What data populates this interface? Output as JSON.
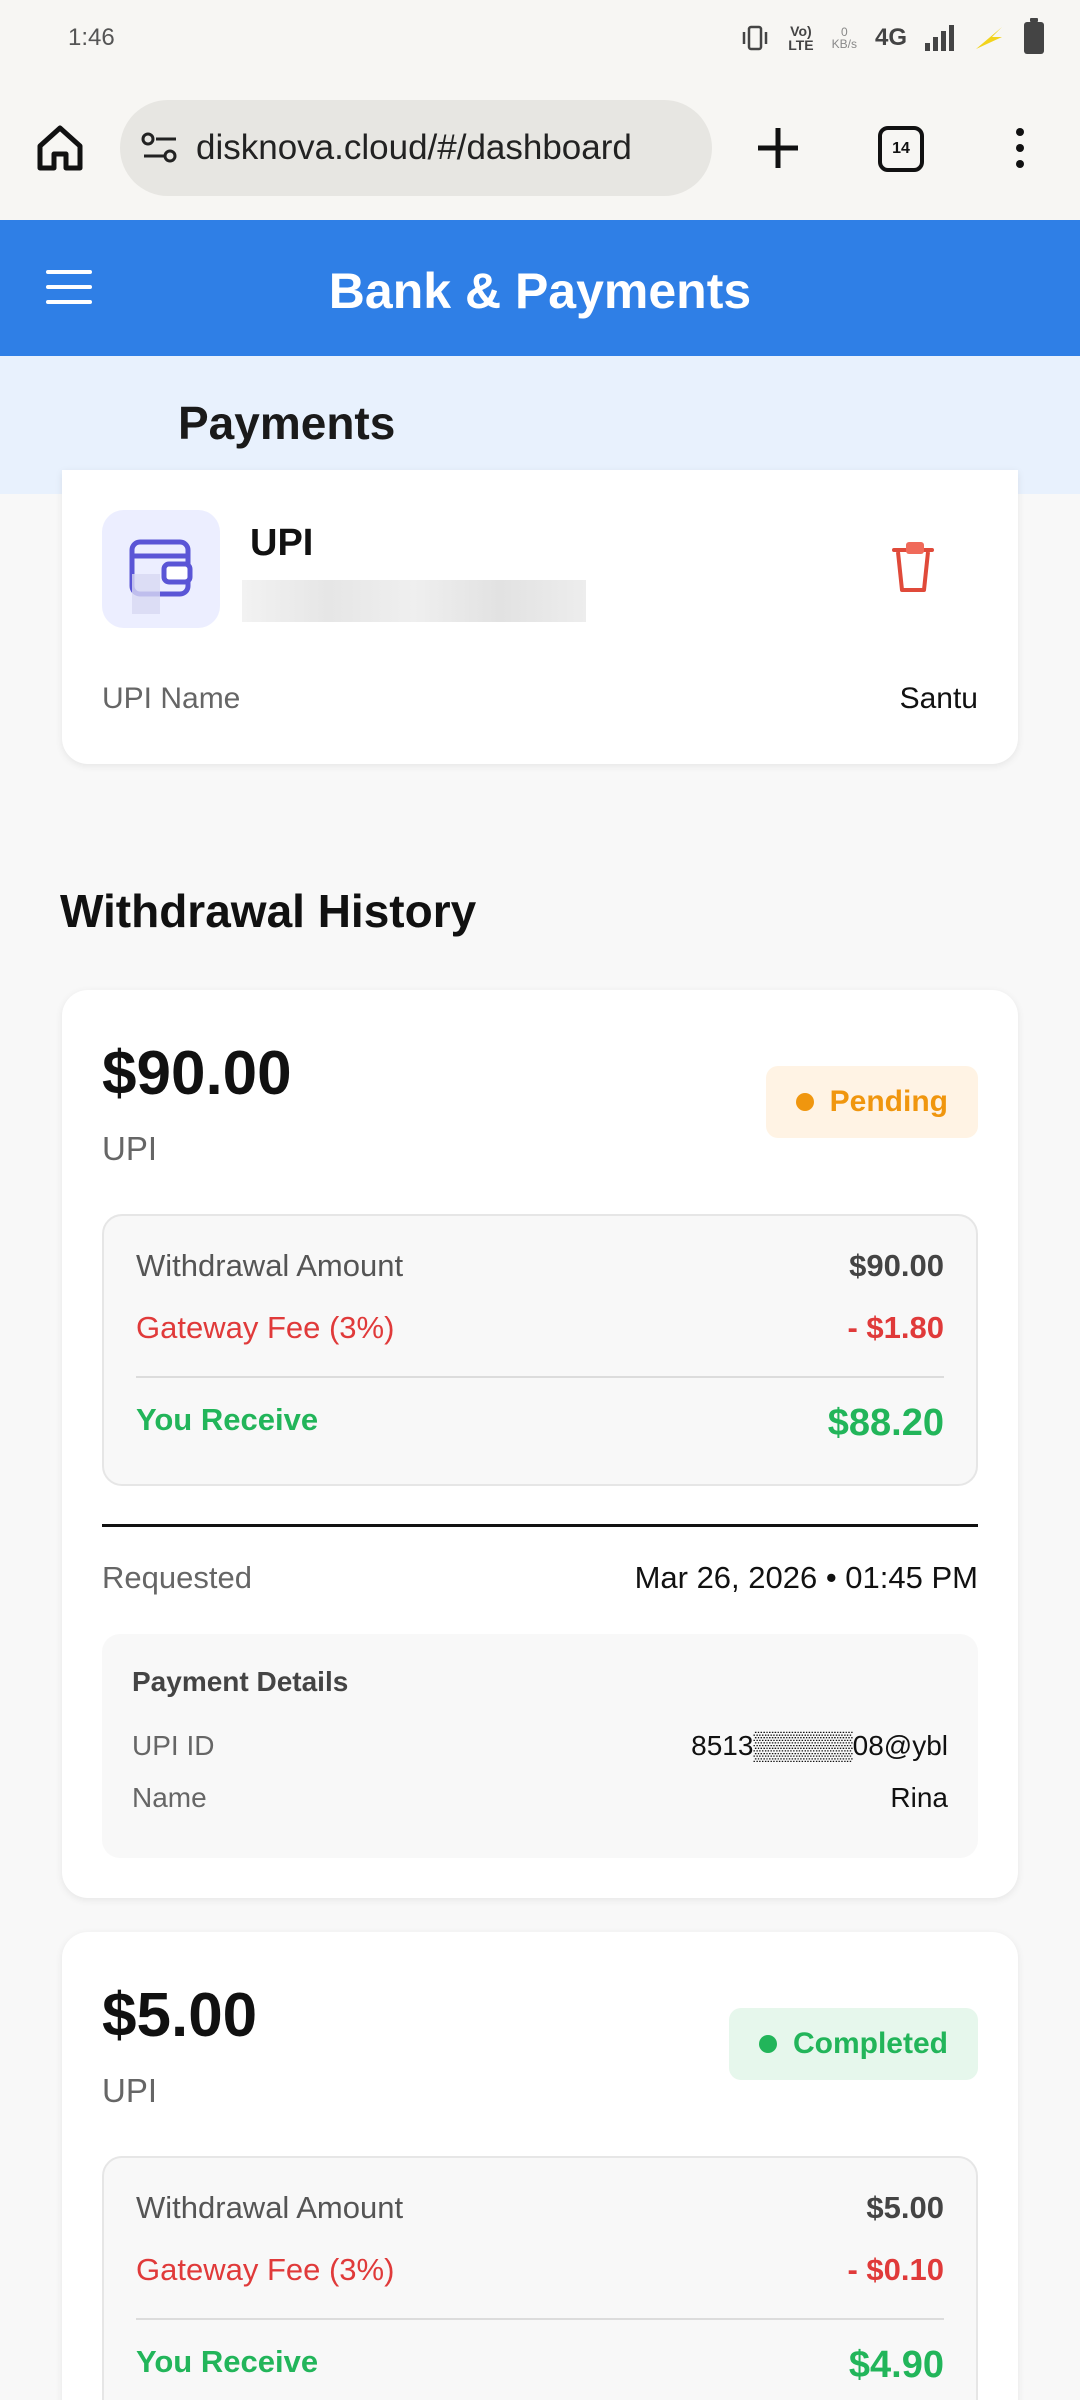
{
  "status_bar": {
    "time": "1:46",
    "lte_top": "Vo)",
    "lte_bottom": "LTE",
    "speed_top": "0",
    "speed_bottom": "KB/s",
    "network": "4G"
  },
  "browser": {
    "url": "disknova.cloud/#/dashboard",
    "tab_count": "14"
  },
  "header": {
    "title": "Bank & Payments"
  },
  "subheader": {
    "title": "Payments"
  },
  "upi_account": {
    "type": "UPI",
    "name_label": "UPI Name",
    "name_value": "Santu"
  },
  "withdrawal_history": {
    "title": "Withdrawal History",
    "items": [
      {
        "amount": "$90.00",
        "method": "UPI",
        "status": "Pending",
        "amount_label": "Withdrawal Amount",
        "amount_value": "$90.00",
        "fee_label": "Gateway Fee (3%)",
        "fee_value": "- $1.80",
        "receive_label": "You Receive",
        "receive_value": "$88.20",
        "requested_label": "Requested",
        "requested_value": "Mar 26, 2026 • 01:45 PM",
        "details_title": "Payment Details",
        "upi_id_label": "UPI ID",
        "upi_id_value": "8513▒▒▒▒▒08@ybl",
        "name_label": "Name",
        "name_value": "Rina"
      },
      {
        "amount": "$5.00",
        "method": "UPI",
        "status": "Completed",
        "amount_label": "Withdrawal Amount",
        "amount_value": "$5.00",
        "fee_label": "Gateway Fee (3%)",
        "fee_value": "- $0.10",
        "receive_label": "You Receive",
        "receive_value": "$4.90"
      }
    ]
  },
  "colors": {
    "header_blue": "#2f7fe6",
    "pending": "#f0960e",
    "completed": "#22b55a",
    "fee_red": "#e03a3a"
  },
  "icons": [
    "home-icon",
    "site-settings-icon",
    "plus-icon",
    "tabs-icon",
    "more-vert-icon",
    "hamburger-icon",
    "wallet-icon",
    "trash-icon"
  ]
}
